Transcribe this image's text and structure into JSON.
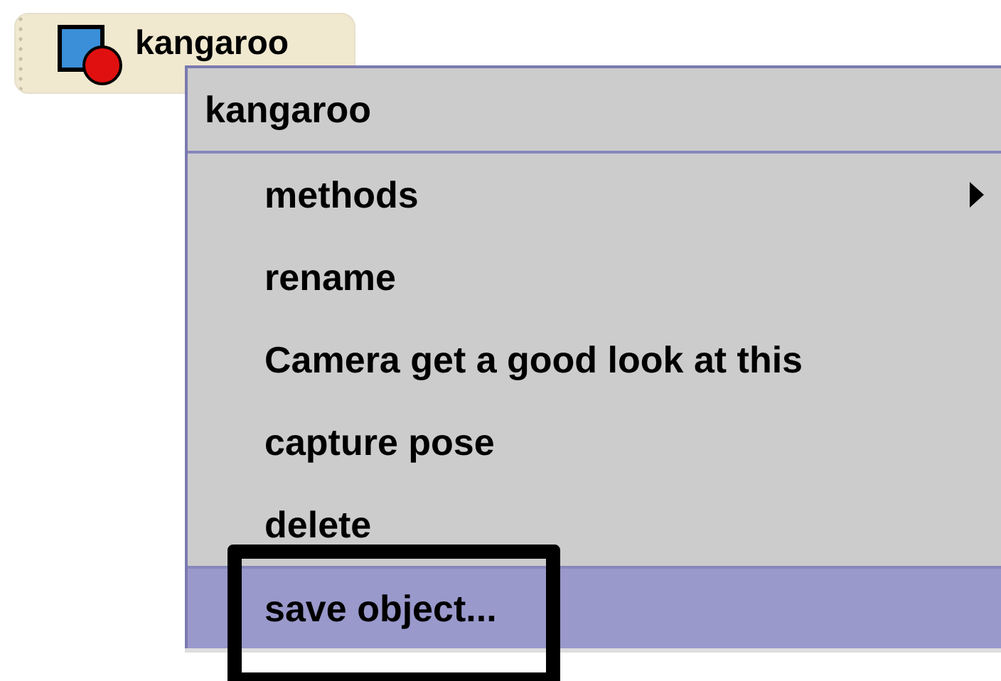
{
  "object_tile": {
    "label": "kangaroo"
  },
  "context_menu": {
    "title": "kangaroo",
    "items": [
      {
        "label": "methods",
        "has_submenu": true,
        "selected": false,
        "outlined": false
      },
      {
        "label": "rename",
        "has_submenu": false,
        "selected": false,
        "outlined": false
      },
      {
        "label": "Camera get a good look at this",
        "has_submenu": false,
        "selected": false,
        "outlined": false
      },
      {
        "label": "capture pose",
        "has_submenu": false,
        "selected": false,
        "outlined": false
      },
      {
        "label": "delete",
        "has_submenu": false,
        "selected": false,
        "outlined": false
      },
      {
        "label": "save object...",
        "has_submenu": false,
        "selected": true,
        "outlined": true
      }
    ]
  }
}
